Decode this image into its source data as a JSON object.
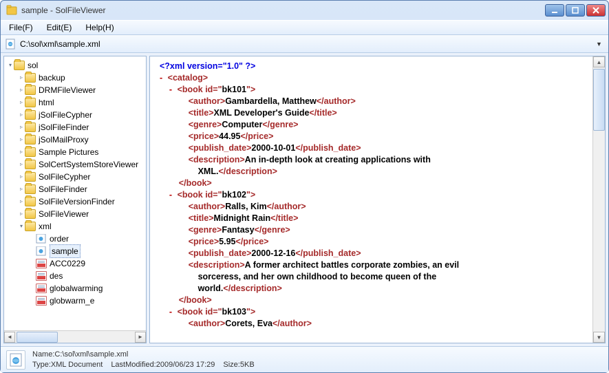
{
  "window": {
    "title": "sample - SolFileViewer"
  },
  "menubar": {
    "file": "File(F)",
    "edit": "Edit(E)",
    "help": "Help(H)"
  },
  "pathbar": {
    "path": "C:\\sol\\xml\\sample.xml",
    "drop": "▼"
  },
  "tree": {
    "root": "sol",
    "items": [
      {
        "label": "backup",
        "type": "folder"
      },
      {
        "label": "DRMFileViewer",
        "type": "folder"
      },
      {
        "label": "html",
        "type": "folder"
      },
      {
        "label": "jSolFileCypher",
        "type": "folder"
      },
      {
        "label": "jSolFileFinder",
        "type": "folder"
      },
      {
        "label": "jSolMailProxy",
        "type": "folder"
      },
      {
        "label": "Sample Pictures",
        "type": "folder"
      },
      {
        "label": "SolCertSystemStoreViewer",
        "type": "folder"
      },
      {
        "label": "SolFileCypher",
        "type": "folder"
      },
      {
        "label": "SolFileFinder",
        "type": "folder"
      },
      {
        "label": "SolFileVersionFinder",
        "type": "folder"
      },
      {
        "label": "SolFileViewer",
        "type": "folder"
      }
    ],
    "xml_folder": "xml",
    "xml_children": [
      {
        "label": "order",
        "type": "xml"
      },
      {
        "label": "sample",
        "type": "xml",
        "selected": true
      },
      {
        "label": "ACC0229",
        "type": "pdf"
      },
      {
        "label": "des",
        "type": "pdf"
      },
      {
        "label": "globalwarming",
        "type": "pdf"
      },
      {
        "label": "globwarm_e",
        "type": "pdf"
      }
    ]
  },
  "xml": {
    "decl": "<?xml version=\"1.0\" ?>",
    "catalog_open": "<catalog>",
    "books": [
      {
        "id": "bk101",
        "author": "Gambardella, Matthew",
        "title": "XML Developer's Guide",
        "genre": "Computer",
        "price": "44.95",
        "pub": "2000-10-01",
        "desc": "An in-depth look at creating applications with",
        "desc2": "XML."
      },
      {
        "id": "bk102",
        "author": "Ralls, Kim",
        "title": "Midnight Rain",
        "genre": "Fantasy",
        "price": "5.95",
        "pub": "2000-12-16",
        "desc": "A former architect battles corporate zombies, an evil",
        "desc2": "sorceress, and her own childhood to become queen of the",
        "desc3": "world."
      },
      {
        "id": "bk103",
        "author": "Corets, Eva"
      }
    ]
  },
  "status": {
    "name_label": "Name:",
    "name": "C:\\sol\\xml\\sample.xml",
    "type_label": "Type:",
    "type": "XML Document",
    "mod_label": "LastModified:",
    "mod": "2009/06/23 17:29",
    "size_label": "Size:",
    "size": "5KB"
  },
  "glyph": {
    "left": "◄",
    "right": "►",
    "up": "▲",
    "down": "▼"
  }
}
